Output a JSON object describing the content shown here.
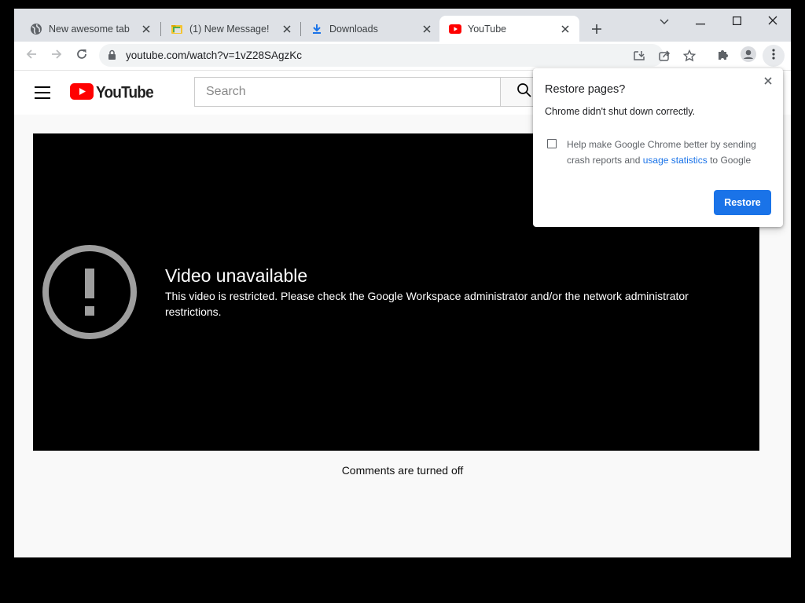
{
  "browser": {
    "tabs": [
      {
        "label": "New awesome tab",
        "icon": "globe-icon",
        "active": false
      },
      {
        "label": "(1) New Message!",
        "icon": "folder-icon",
        "active": false
      },
      {
        "label": "Downloads",
        "icon": "download-icon",
        "active": false
      },
      {
        "label": "YouTube",
        "icon": "youtube-icon",
        "active": true
      }
    ],
    "url": "youtube.com/watch?v=1vZ28SAgzKc"
  },
  "youtube": {
    "logo_text": "YouTube",
    "search_placeholder": "Search",
    "error_title": "Video unavailable",
    "error_message": "This video is restricted. Please check the Google Workspace administrator and/or the network administrator restrictions.",
    "comments_status": "Comments are turned off"
  },
  "restore_popup": {
    "title": "Restore pages?",
    "message": "Chrome didn't shut down correctly.",
    "checkbox_text_before": "Help make Google Chrome better by sending crash reports and ",
    "checkbox_link": "usage statistics",
    "checkbox_text_after": " to Google",
    "button_label": "Restore"
  },
  "colors": {
    "accent_blue": "#1a73e8",
    "youtube_red": "#ff0000",
    "tabstrip": "#dee1e6"
  }
}
